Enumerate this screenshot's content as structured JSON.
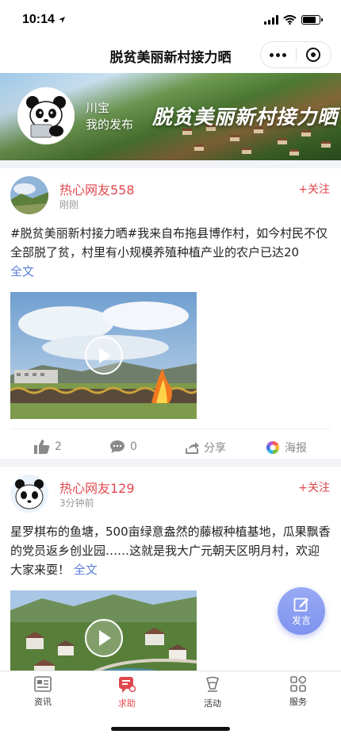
{
  "status_bar": {
    "time": "10:14"
  },
  "nav": {
    "title": "脱贫美丽新村接力晒"
  },
  "banner": {
    "user_name": "川宝",
    "user_subtitle": "我的发布",
    "title": "脱贫美丽新村接力晒"
  },
  "posts": [
    {
      "author": "热心网友558",
      "time": "刚刚",
      "follow_label": "+关注",
      "text": "#脱贫美丽新村接力晒#我来自布拖县博作村，如今村民不仅全部脱了贫，村里有小规模养殖种植产业的农户已达20",
      "more": "全文",
      "likes": "2",
      "comments": "0",
      "share_label": "分享",
      "poster_label": "海报"
    },
    {
      "author": "热心网友129",
      "time": "3分钟前",
      "follow_label": "+关注",
      "text": "星罗棋布的鱼塘，500亩绿意盎然的藤椒种植基地，瓜果飘香的党员返乡创业园……这就是我大广元朝天区明月村，欢迎大家来耍！",
      "more": "全文"
    }
  ],
  "fab": {
    "label": "发言"
  },
  "tabs": [
    {
      "label": "资讯",
      "icon": "news-icon"
    },
    {
      "label": "求助",
      "icon": "help-chat-icon",
      "active": true
    },
    {
      "label": "活动",
      "icon": "activity-icon"
    },
    {
      "label": "服务",
      "icon": "services-grid-icon"
    }
  ],
  "colors": {
    "accent_red": "#e0484e",
    "link_blue": "#5b7fd6",
    "fab_blue": "#8a9cf2"
  }
}
